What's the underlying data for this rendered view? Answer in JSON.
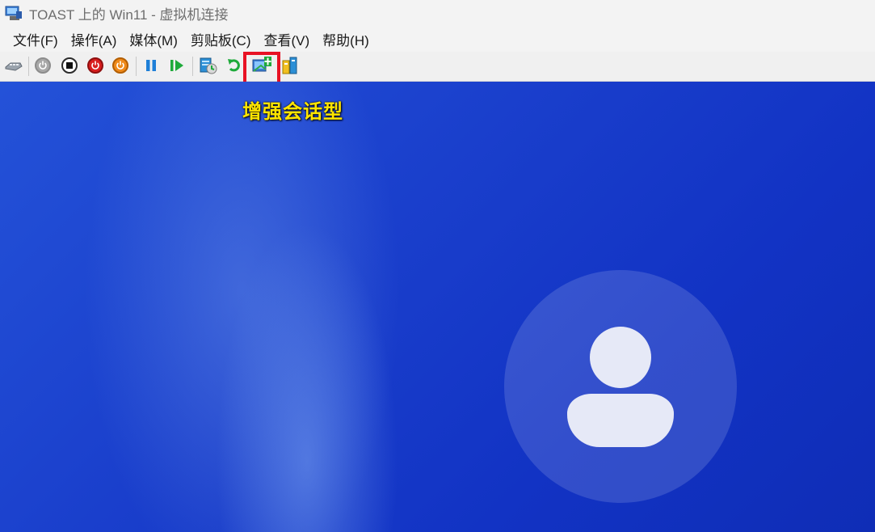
{
  "window": {
    "title": "TOAST 上的 Win11 - 虚拟机连接"
  },
  "menu": [
    {
      "label": "文件(F)"
    },
    {
      "label": "操作(A)"
    },
    {
      "label": "媒体(M)"
    },
    {
      "label": "剪贴板(C)"
    },
    {
      "label": "查看(V)"
    },
    {
      "label": "帮助(H)"
    }
  ],
  "toolbar": {
    "icons": [
      "ctrl-alt-del-icon",
      "start-icon",
      "turn-off-icon",
      "shutdown-icon",
      "save-icon",
      "pause-icon",
      "resume-icon",
      "checkpoint-icon",
      "revert-icon",
      "enhanced-session-icon",
      "share-icon"
    ]
  },
  "annotation": {
    "text": "增强会话型",
    "highlight_color": "#e81224",
    "text_color": "#ffe500"
  },
  "desktop": {
    "username": ""
  }
}
